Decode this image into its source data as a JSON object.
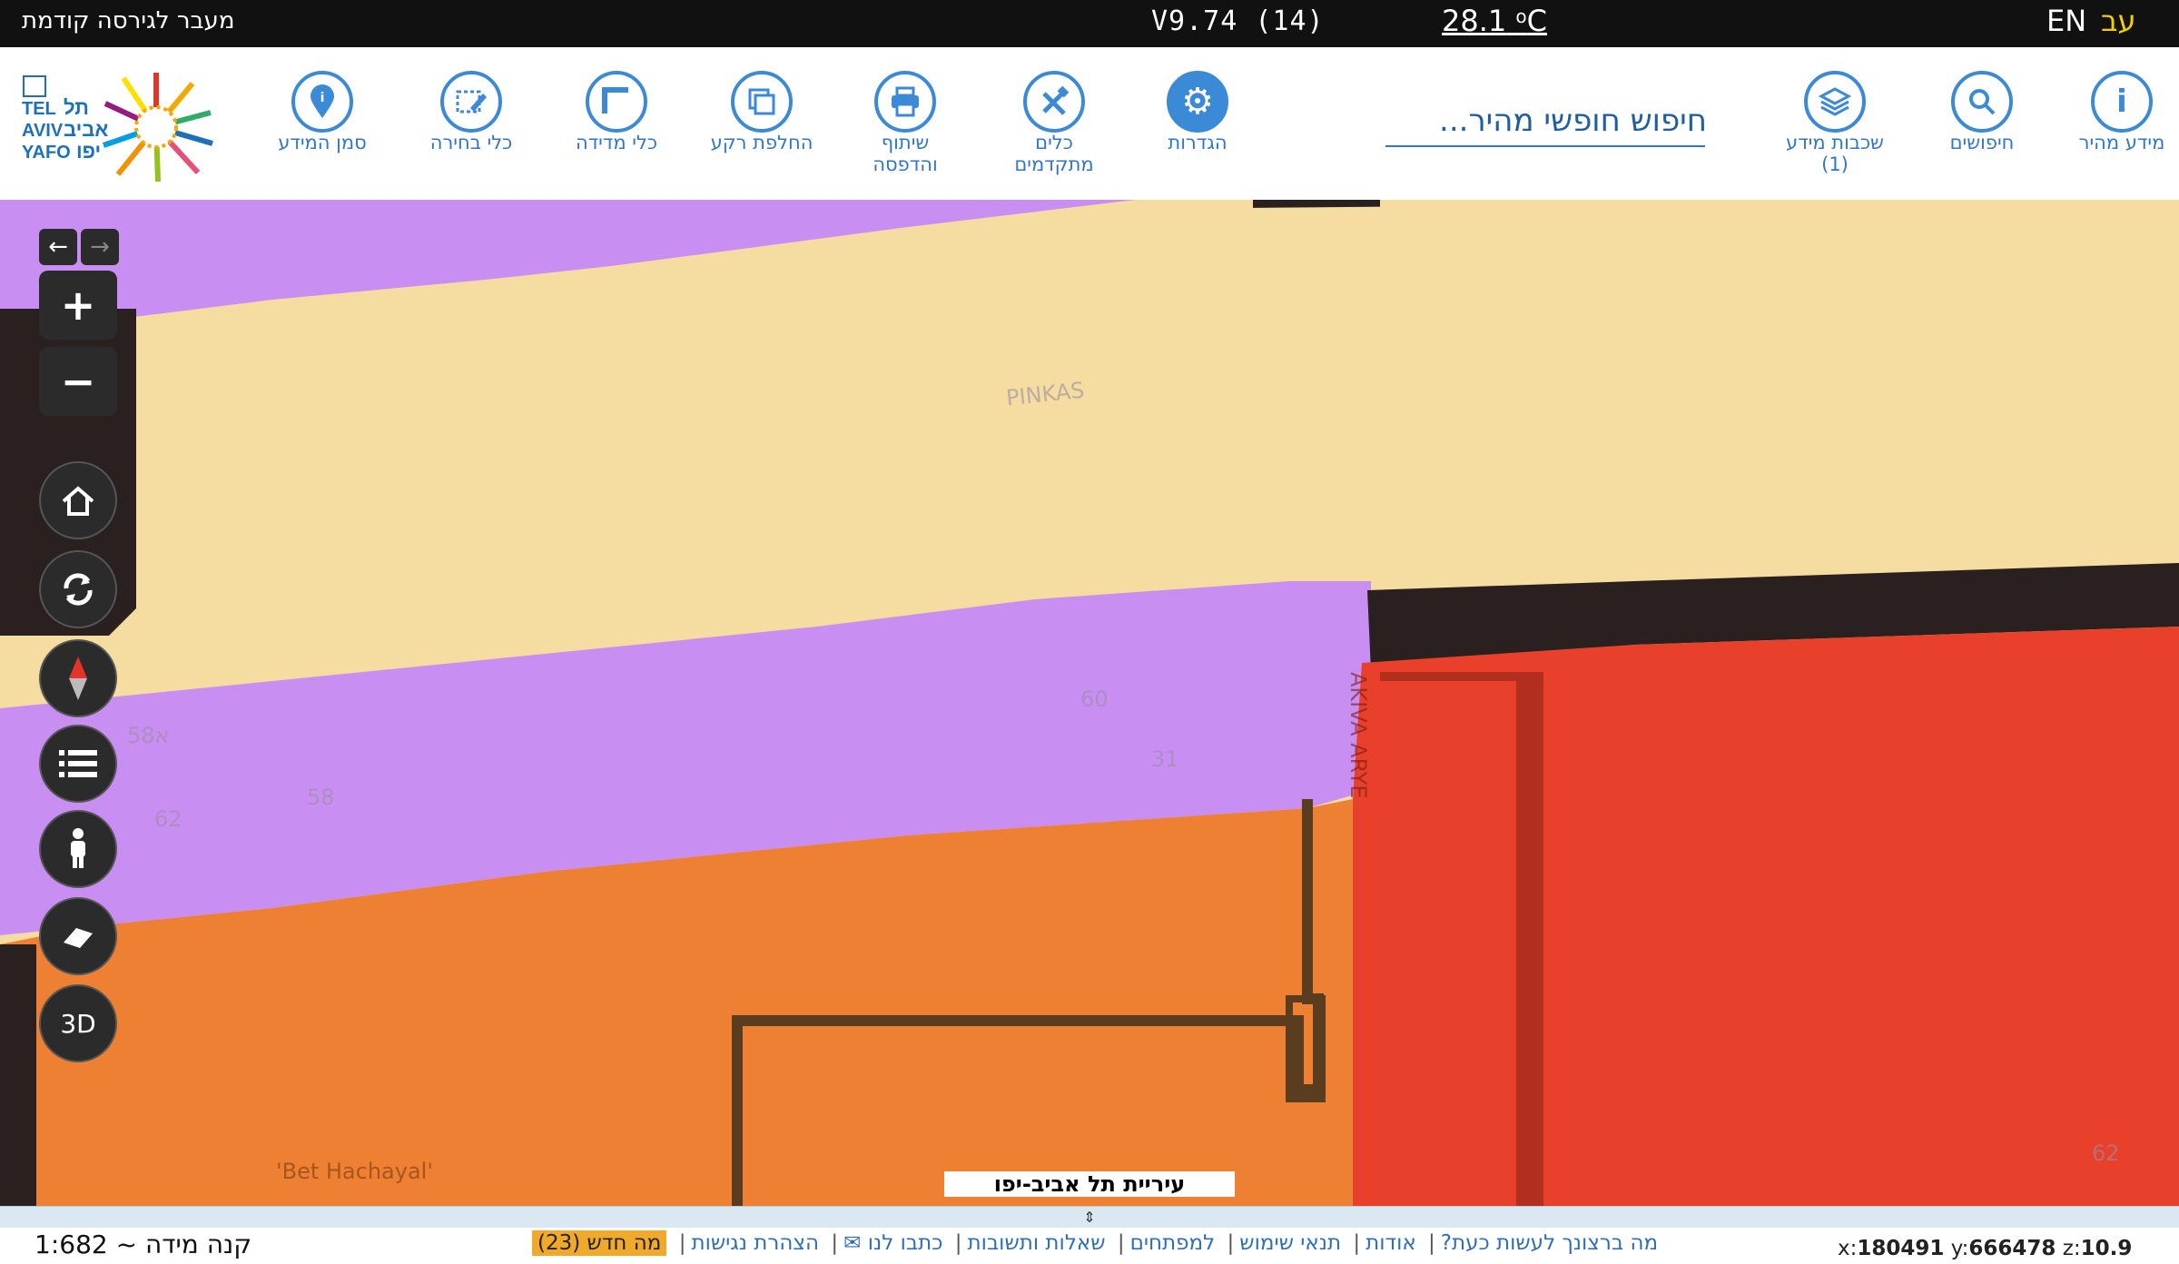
{
  "topbar": {
    "prev_version": "מעבר לגירסה קודמת",
    "version": "V9.74 (14)",
    "temperature": "28.1",
    "temp_unit": "C",
    "lang_en": "EN",
    "lang_he": "עב"
  },
  "toolbar": {
    "tools": [
      {
        "label": "מידע מהיר",
        "icon": "info-icon"
      },
      {
        "label": "חיפושים",
        "icon": "search-icon"
      },
      {
        "label": "שכבות מידע",
        "sub": "(1)",
        "icon": "layers-icon"
      },
      {
        "label": "הגדרות",
        "icon": "gear-icon"
      },
      {
        "label": "כלים",
        "sub": "מתקדמים",
        "icon": "tools-icon"
      },
      {
        "label": "שיתוף",
        "sub": "והדפסה",
        "icon": "printer-icon"
      },
      {
        "label": "החלפת רקע",
        "icon": "basemap-icon"
      },
      {
        "label": "כלי מדידה",
        "icon": "ruler-icon"
      },
      {
        "label": "כלי בחירה",
        "icon": "select-icon"
      },
      {
        "label": "סמן המידע",
        "icon": "info-pin-icon"
      }
    ],
    "search_placeholder": "חיפוש חופשי מהיר..."
  },
  "logo": {
    "text_en": "TEL AVIV YAFO",
    "text_he": "תל אביב יפו"
  },
  "map": {
    "street_labels": [
      "PINKAS",
      "AKIVA ARYE",
      "'Bet Hachayal'"
    ],
    "parcel_numbers": [
      "60",
      "31",
      "58א",
      "58",
      "62",
      "62"
    ],
    "city_label": "עיריית תל אביב-יפו",
    "controls": [
      "zoom-in",
      "zoom-out",
      "home",
      "refresh",
      "compass",
      "legend",
      "street-view",
      "eraser",
      "3D"
    ],
    "control_3d": "3D"
  },
  "footer": {
    "scale": "קנה מידה ~ 1:682",
    "links": [
      "מה ברצונך לעשות כעת?",
      "אודות",
      "תנאי שימוש",
      "למפתחים",
      "שאלות ותשובות",
      "כתבו לנו ✉",
      "הצהרת נגישות"
    ],
    "news": "מה חדש (23)",
    "coord_x_label": "x:",
    "coord_x": "180491",
    "coord_y_label": "y:",
    "coord_y": "666478",
    "coord_z_label": "z:",
    "coord_z": "10.9"
  }
}
